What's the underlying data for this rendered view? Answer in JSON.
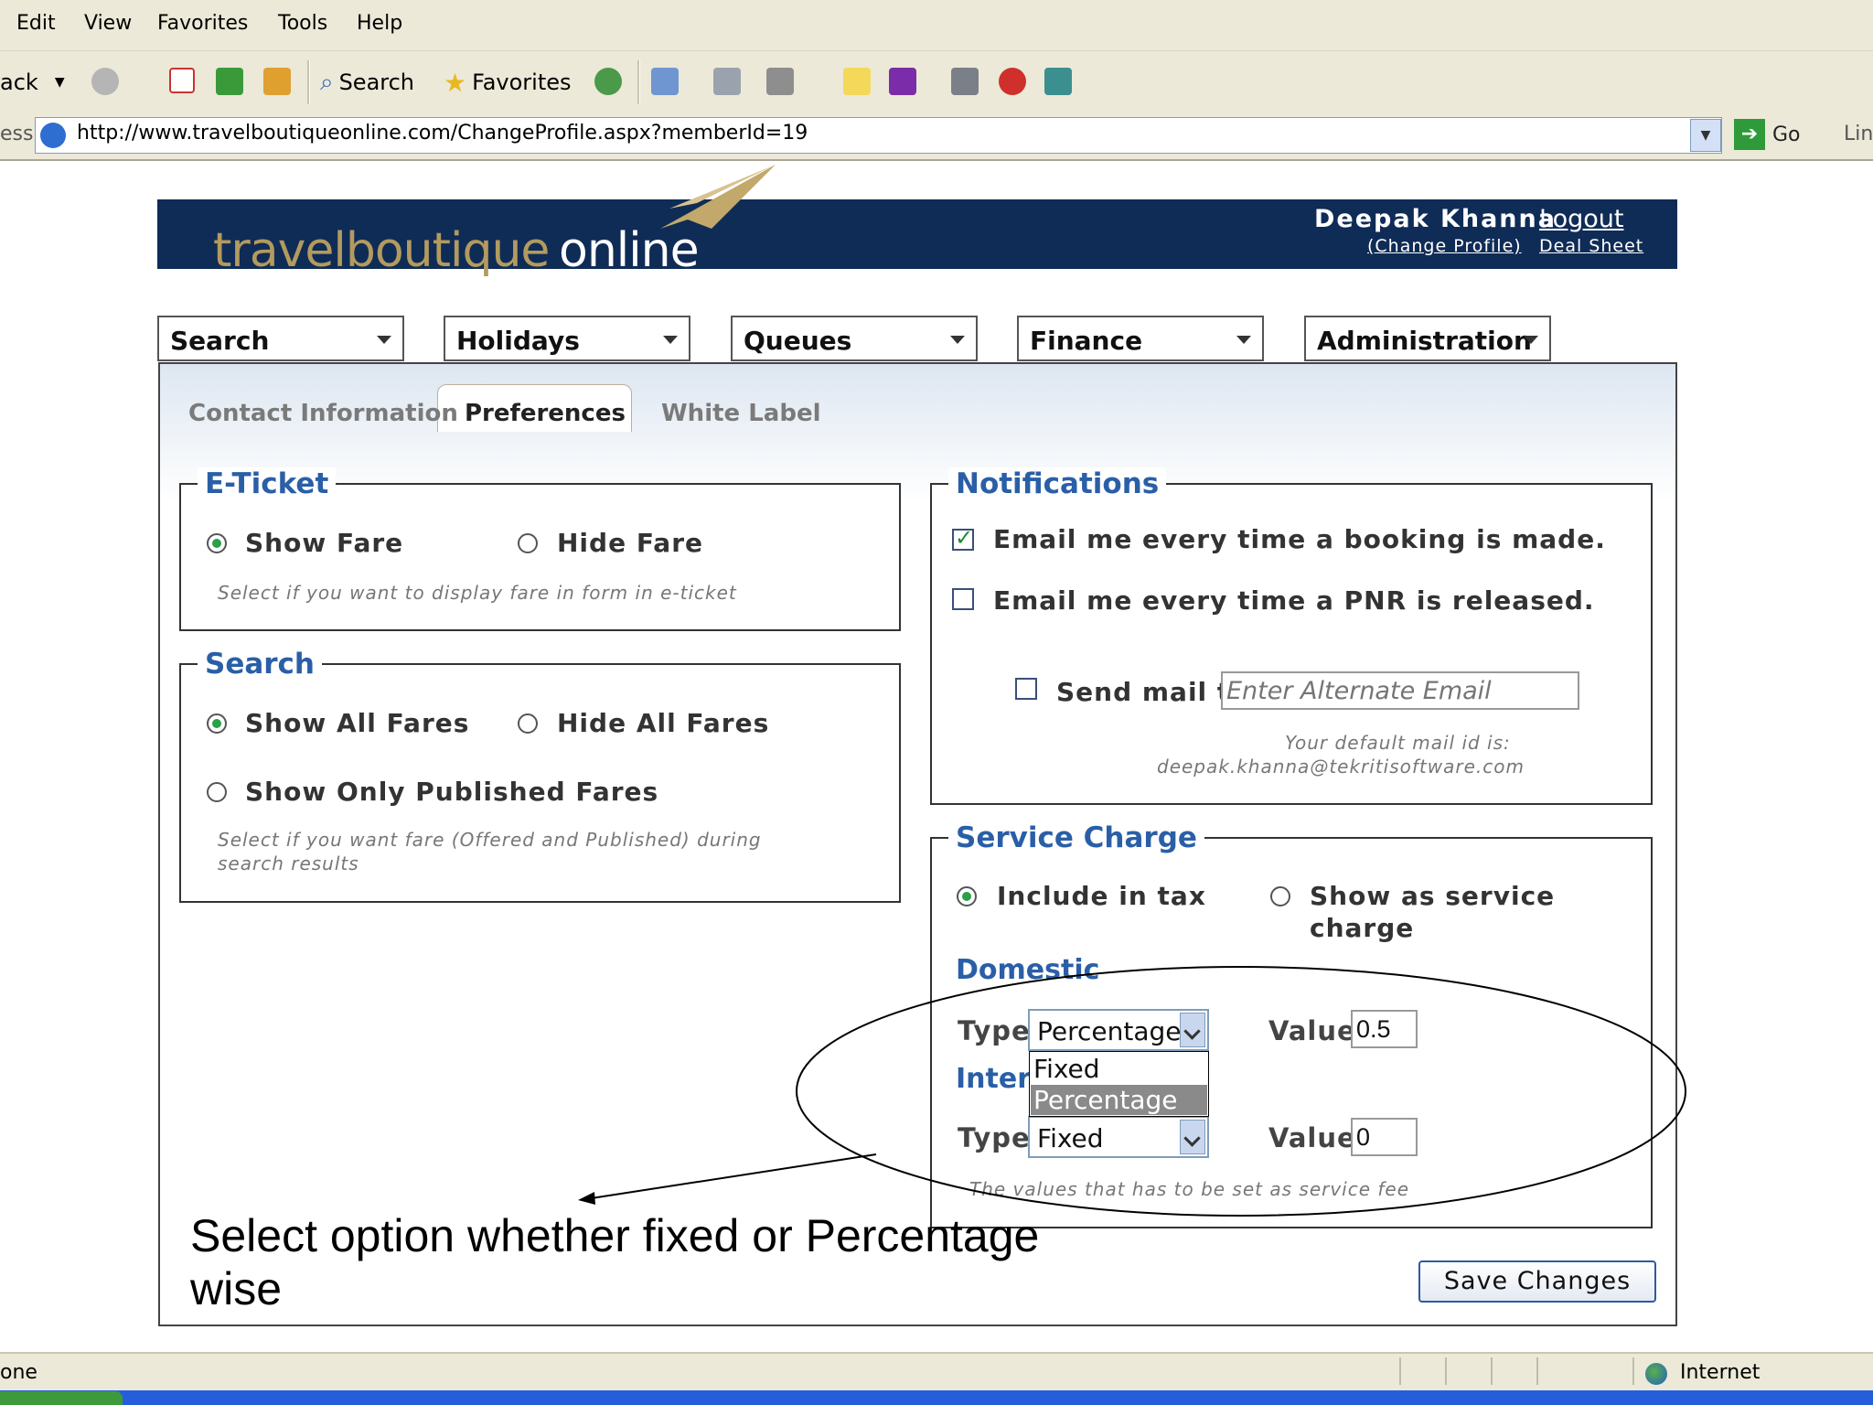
{
  "browser": {
    "menu": [
      "Edit",
      "View",
      "Favorites",
      "Tools",
      "Help"
    ],
    "toolbar": {
      "back": "ack",
      "search": "Search",
      "favorites": "Favorites"
    },
    "address_label": "ess",
    "url": "http://www.travelboutiqueonline.com/ChangeProfile.aspx?memberId=19",
    "go": "Go",
    "links": "Lin",
    "status": "one",
    "zone": "Internet"
  },
  "header": {
    "logo_part1": "travelboutique",
    "logo_part2": "online",
    "user": "Deepak Khanna",
    "logout": "Logout",
    "change_profile": "(Change Profile)",
    "deal_sheet": "Deal Sheet"
  },
  "nav": [
    "Search",
    "Holidays",
    "Queues",
    "Finance",
    "Administration"
  ],
  "tabs": {
    "contact": "Contact Information",
    "preferences": "Preferences",
    "white_label": "White Label"
  },
  "eticket": {
    "legend": "E-Ticket",
    "show_fare": "Show Fare",
    "hide_fare": "Hide Fare",
    "hint": "Select if you want to display fare in form in e-ticket"
  },
  "search": {
    "legend": "Search",
    "show_all": "Show All Fares",
    "hide_all": "Hide All Fares",
    "show_published": "Show Only Published Fares",
    "hint_line1": "Select if you want fare (Offered and Published) during",
    "hint_line2": "search results"
  },
  "notifications": {
    "legend": "Notifications",
    "booking": "Email me every time a booking is made.",
    "pnr": "Email me every time a PNR is released.",
    "send_mail": "Send mail to",
    "alt_email_placeholder": "Enter Alternate Email",
    "default_line1": "Your default mail id is:",
    "default_line2": "deepak.khanna@tekritisoftware.com"
  },
  "service_charge": {
    "legend": "Service Charge",
    "include_tax": "Include in tax",
    "show_as_line1": "Show as service",
    "show_as_line2": "charge",
    "domestic": "Domestic",
    "international": "Intern",
    "type_label": "Type",
    "value_label": "Value",
    "domestic_type": "Percentage",
    "domestic_value": "0.5",
    "intl_type": "Fixed",
    "intl_value": "0",
    "options": [
      "Fixed",
      "Percentage"
    ],
    "hint": "The values that has to be set as service fee"
  },
  "save": "Save Changes",
  "annotation": {
    "line1": "Select option whether fixed or Percentage",
    "line2": "wise"
  }
}
